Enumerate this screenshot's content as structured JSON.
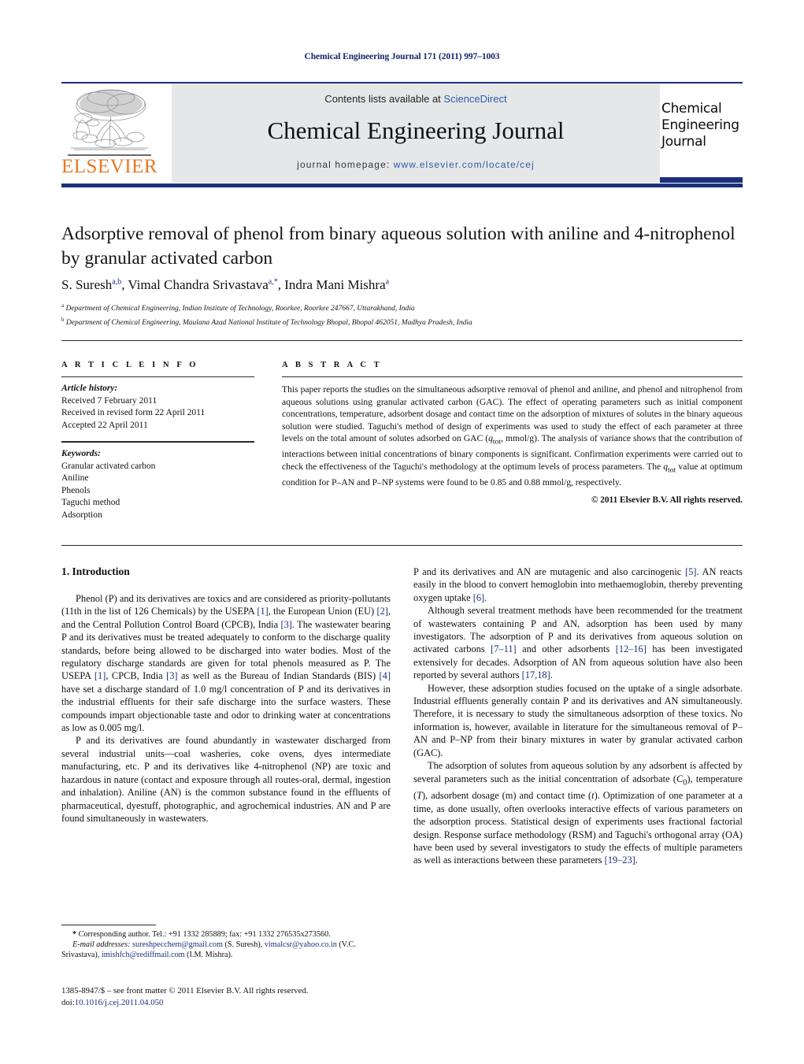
{
  "running_head": "Chemical Engineering Journal 171 (2011) 997–1003",
  "masthead": {
    "publisher_logo_text": "ELSEVIER",
    "contents_prefix": "Contents lists available at ",
    "contents_link": "ScienceDirect",
    "journal_title": "Chemical Engineering Journal",
    "homepage_prefix": "journal homepage: ",
    "homepage_url": "www.elsevier.com/locate/cej",
    "cover_title_line1": "Chemical",
    "cover_title_line2": "Engineering",
    "cover_title_line3": "Journal"
  },
  "article": {
    "title": "Adsorptive removal of phenol from binary aqueous solution with aniline and 4-nitrophenol by granular activated carbon",
    "authors_html": "S. Suresh<sup>a,b</sup>, Vimal Chandra Srivastava<sup>a,*</sup>, Indra Mani Mishra<sup>a</sup>",
    "affiliation_a": "Department of Chemical Engineering, Indian Institute of Technology, Roorkee, Roorkee 247667, Uttarakhand, India",
    "affiliation_b": "Department of Chemical Engineering, Maulana Azad National Institute of Technology Bhopal, Bhopal 462051, Madhya Pradesh, India"
  },
  "article_info": {
    "heading": "A R T I C L E   I N F O",
    "history_label": "Article history:",
    "history": [
      "Received 7 February 2011",
      "Received in revised form 22 April 2011",
      "Accepted 22 April 2011"
    ],
    "keywords_label": "Keywords:",
    "keywords": [
      "Granular activated carbon",
      "Aniline",
      "Phenols",
      "Taguchi method",
      "Adsorption"
    ]
  },
  "abstract": {
    "heading": "A B S T R A C T",
    "text_html": "This paper reports the studies on the simultaneous adsorptive removal of phenol and aniline, and phenol and nitrophenol from aqueous solutions using granular activated carbon (GAC). The effect of operating parameters such as initial component concentrations, temperature, adsorbent dosage and contact time on the adsorption of mixtures of solutes in the binary aqueous solution were studied. Taguchi's method of design of experiments was used to study the effect of each parameter at three levels on the total amount of solutes adsorbed on GAC (<span class=\"it\">q</span><sub>tot</sub>, mmol/g). The analysis of variance shows that the contribution of interactions between initial concentrations of binary components is significant. Confirmation experiments were carried out to check the effectiveness of the Taguchi's methodology at the optimum levels of process parameters. The <span class=\"it\">q</span><sub>tot</sub> value at optimum condition for P–AN and P–NP systems were found to be 0.85 and 0.88 mmol/g, respectively.",
    "copyright": "© 2011 Elsevier B.V. All rights reserved."
  },
  "body": {
    "section_title": "1.  Introduction",
    "left_paragraphs_html": [
      "Phenol (P) and its derivatives are toxics and are considered as priority-pollutants (11th in the list of 126 Chemicals) by the USEPA <span class=\"ref\">[1]</span>, the European Union (EU) <span class=\"ref\">[2]</span>, and the Central Pollution Control Board (CPCB), India <span class=\"ref\">[3]</span>. The wastewater bearing P and its derivatives must be treated adequately to conform to the discharge quality standards, before being allowed to be discharged into water bodies. Most of the regulatory discharge standards are given for total phenols measured as P. The USEPA <span class=\"ref\">[1]</span>, CPCB, India <span class=\"ref\">[3]</span> as well as the Bureau of Indian Standards (BIS) <span class=\"ref\">[4]</span> have set a discharge standard of 1.0 mg/l concentration of P and its derivatives in the industrial effluents for their safe discharge into the surface wasters. These compounds impart objectionable taste and odor to drinking water at concentrations as low as 0.005 mg/l.",
      "P and its derivatives are found abundantly in wastewater discharged from several industrial units—coal washeries, coke ovens, dyes intermediate manufacturing, etc. P and its derivatives like 4-nitrophenol (NP) are toxic and hazardous in nature (contact and exposure through all routes-oral, dermal, ingestion and inhalation). Aniline (AN) is the common substance found in the effluents of pharmaceutical, dyestuff, photographic, and agrochemical industries. AN and P are found simultaneously in wastewaters."
    ],
    "right_paragraphs_html": [
      "P and its derivatives and AN are mutagenic and also carcinogenic <span class=\"ref\">[5]</span>. AN reacts easily in the blood to convert hemoglobin into methaemoglobin, thereby preventing oxygen uptake <span class=\"ref\">[6]</span>.",
      "Although several treatment methods have been recommended for the treatment of wastewaters containing P and AN, adsorption has been used by many investigators. The adsorption of P and its derivatives from aqueous solution on activated carbons <span class=\"ref\">[7–11]</span> and other adsorbents <span class=\"ref\">[12–16]</span> has been investigated extensively for decades. Adsorption of AN from aqueous solution have also been reported by several authors <span class=\"ref\">[17,18]</span>.",
      "However, these adsorption studies focused on the uptake of a single adsorbate. Industrial effluents generally contain P and its derivatives and AN simultaneously. Therefore, it is necessary to study the simultaneous adsorption of these toxics. No information is, however, available in literature for the simultaneous removal of P–AN and P–NP from their binary mixtures in water by granular activated carbon (GAC).",
      "The adsorption of solutes from aqueous solution by any adsorbent is affected by several parameters such as the initial concentration of adsorbate (<span class=\"it\">C</span><sub>0</sub>), temperature (<span class=\"it\">T</span>), adsorbent dosage (m) and contact time (<span class=\"it\">t</span>). Optimization of one parameter at a time, as done usually, often overlooks interactive effects of various parameters on the adsorption process. Statistical design of experiments uses fractional factorial design. Response surface methodology (RSM) and Taguchi's orthogonal array (OA) have been used by several investigators to study the effects of multiple parameters as well as interactions between these parameters <span class=\"ref\">[19–23]</span>."
    ]
  },
  "footnote": {
    "corresponding_html": "<b>*</b> Corresponding author. Tel.: +91 1332 285889; fax: +91 1332 276535x273560.",
    "emails_html": "<span class=\"it\">E-mail addresses:</span> <span class=\"mail\">sureshpecchem@gmail.com</span> (S. Suresh), <span class=\"mail\">vimalcsr@yahoo.co.in</span> (V.C. Srivastava), <span class=\"mail\">imishfch@rediffmail.com</span> (I.M. Mishra)."
  },
  "colophon": {
    "line1": "1385-8947/$ – see front matter © 2011 Elsevier B.V. All rights reserved.",
    "doi_prefix": "doi:",
    "doi": "10.1016/j.cej.2011.04.050"
  },
  "colors": {
    "accent_blue": "#1b2f7a",
    "link_blue": "#2a5caa",
    "elsevier_orange": "#e87722",
    "panel_gray": "#e6e7e9"
  }
}
